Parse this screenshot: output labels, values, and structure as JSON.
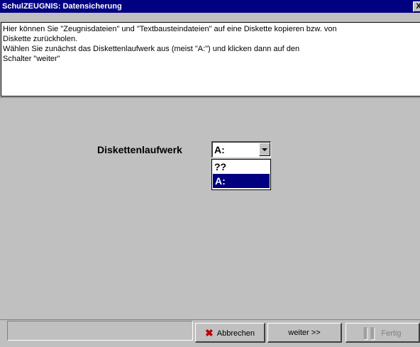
{
  "window": {
    "title": "SchulZEUGNIS: Datensicherung",
    "close_label": "X"
  },
  "info": {
    "line1": "Hier können Sie \"Zeugnisdateien\" und \"Textbausteindateien\" auf eine Diskette kopieren bzw. von",
    "line2": "Diskette zurückholen.",
    "line3": "Wählen Sie zunächst das Diskettenlaufwerk aus (meist \"A:\") und klicken dann auf den",
    "line4": "Schalter \"weiter\""
  },
  "drive": {
    "label": "Diskettenlaufwerk",
    "selected": "A:",
    "options": [
      "??",
      "A:"
    ],
    "highlighted_index": 1
  },
  "buttons": {
    "cancel_label": "Abbrechen",
    "cancel_icon": "x-icon",
    "next_label": "weiter >>",
    "finish_label": "Fertig",
    "finish_icon": "finish-icon",
    "finish_enabled": false
  },
  "colors": {
    "titlebar": "#000080",
    "selection": "#000080",
    "cancel_icon": "#c00000",
    "face": "#c0c0c0"
  }
}
